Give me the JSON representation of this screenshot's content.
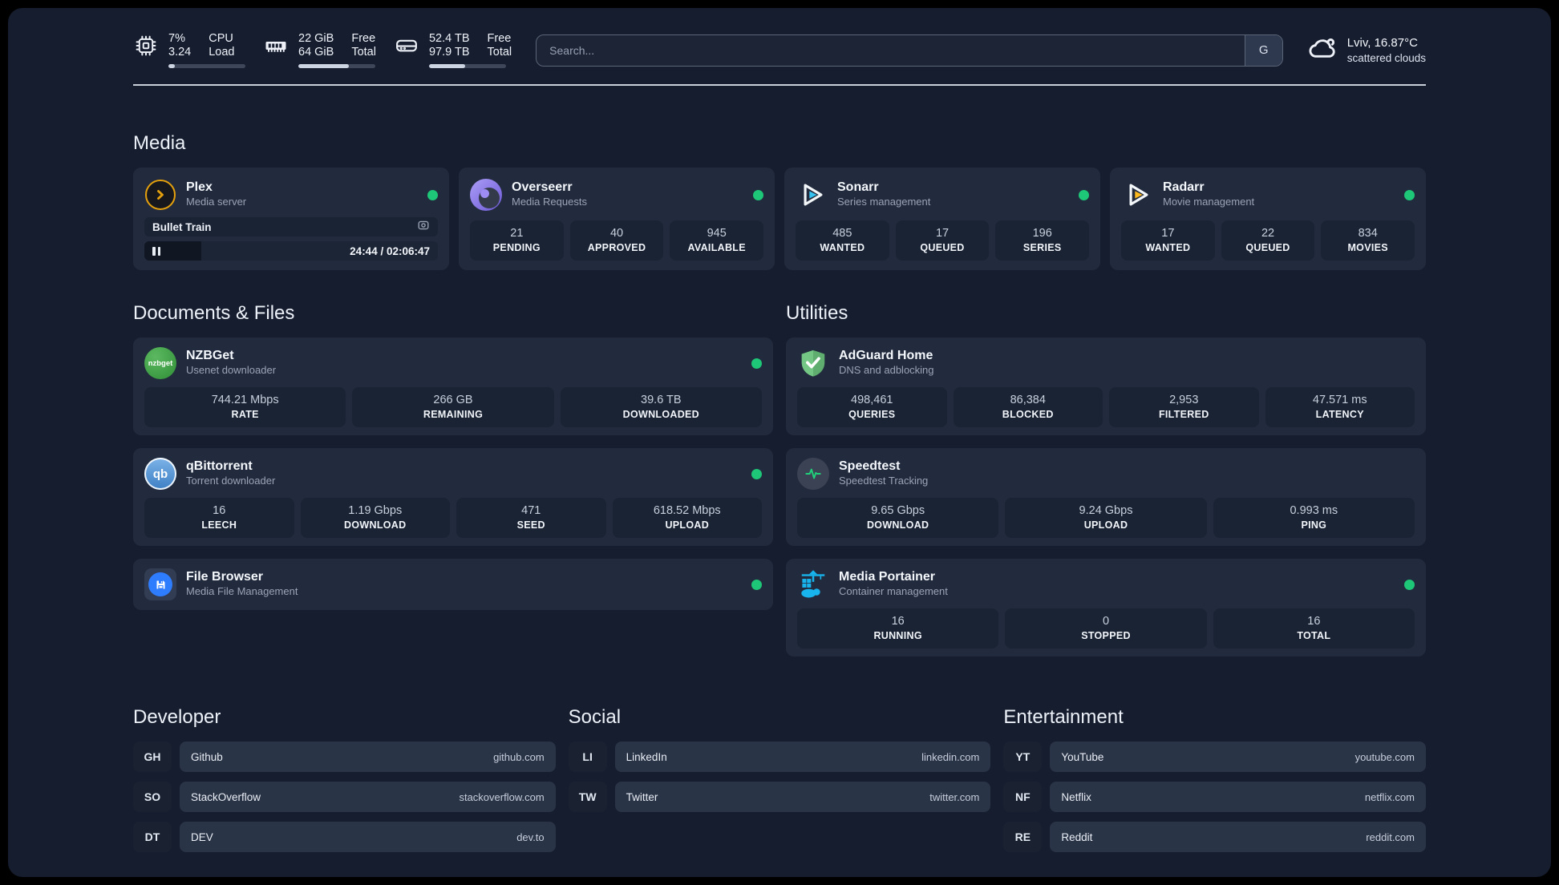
{
  "header": {
    "system_stats": [
      {
        "icon": "cpu-icon",
        "values": [
          "7%",
          "3.24"
        ],
        "labels": [
          "CPU",
          "Load"
        ],
        "progress_percent": 8
      },
      {
        "icon": "ram-icon",
        "values": [
          "22 GiB",
          "64 GiB"
        ],
        "labels": [
          "Free",
          "Total"
        ],
        "progress_percent": 66
      },
      {
        "icon": "disk-icon",
        "values": [
          "52.4 TB",
          "97.9 TB"
        ],
        "labels": [
          "Free",
          "Total"
        ],
        "progress_percent": 47
      }
    ],
    "search": {
      "placeholder": "Search...",
      "button_label": "G"
    },
    "weather": {
      "icon": "cloud-icon",
      "title": "Lviv, 16.87°C",
      "subtitle": "scattered clouds"
    }
  },
  "sections": {
    "media": {
      "title": "Media",
      "cards": [
        {
          "icon": "plex-icon",
          "name": "Plex",
          "subtitle": "Media server",
          "status_online": true,
          "now_playing": {
            "title": "Bullet Train",
            "icon": "camera-icon"
          },
          "player": {
            "state": "paused",
            "icon": "pause-icon",
            "time": "24:44 / 02:06:47",
            "progress_percent": 19.5
          }
        },
        {
          "icon": "overseerr-icon",
          "name": "Overseerr",
          "subtitle": "Media Requests",
          "status_online": true,
          "stats": [
            {
              "value": "21",
              "label": "PENDING"
            },
            {
              "value": "40",
              "label": "APPROVED"
            },
            {
              "value": "945",
              "label": "AVAILABLE"
            }
          ]
        },
        {
          "icon": "sonarr-icon",
          "name": "Sonarr",
          "subtitle": "Series management",
          "status_online": true,
          "stats": [
            {
              "value": "485",
              "label": "WANTED"
            },
            {
              "value": "17",
              "label": "QUEUED"
            },
            {
              "value": "196",
              "label": "SERIES"
            }
          ]
        },
        {
          "icon": "radarr-icon",
          "name": "Radarr",
          "subtitle": "Movie management",
          "status_online": true,
          "stats": [
            {
              "value": "17",
              "label": "WANTED"
            },
            {
              "value": "22",
              "label": "QUEUED"
            },
            {
              "value": "834",
              "label": "MOVIES"
            }
          ]
        }
      ]
    },
    "documents": {
      "title": "Documents & Files",
      "cards": [
        {
          "icon": "nzbget-icon",
          "icon_text": "nzbget",
          "name": "NZBGet",
          "subtitle": "Usenet downloader",
          "status_online": true,
          "stats": [
            {
              "value": "744.21 Mbps",
              "label": "RATE"
            },
            {
              "value": "266 GB",
              "label": "REMAINING"
            },
            {
              "value": "39.6 TB",
              "label": "DOWNLOADED"
            }
          ]
        },
        {
          "icon": "qbittorrent-icon",
          "icon_text": "qb",
          "name": "qBittorrent",
          "subtitle": "Torrent downloader",
          "status_online": true,
          "stats": [
            {
              "value": "16",
              "label": "LEECH"
            },
            {
              "value": "1.19 Gbps",
              "label": "DOWNLOAD"
            },
            {
              "value": "471",
              "label": "SEED"
            },
            {
              "value": "618.52 Mbps",
              "label": "UPLOAD"
            }
          ]
        },
        {
          "icon": "filebrowser-icon",
          "name": "File Browser",
          "subtitle": "Media File Management",
          "status_online": true
        }
      ]
    },
    "utilities": {
      "title": "Utilities",
      "cards": [
        {
          "icon": "adguard-icon",
          "name": "AdGuard Home",
          "subtitle": "DNS and adblocking",
          "status_online": false,
          "stats": [
            {
              "value": "498,461",
              "label": "QUERIES"
            },
            {
              "value": "86,384",
              "label": "BLOCKED"
            },
            {
              "value": "2,953",
              "label": "FILTERED"
            },
            {
              "value": "47.571 ms",
              "label": "LATENCY"
            }
          ]
        },
        {
          "icon": "speedtest-icon",
          "name": "Speedtest",
          "subtitle": "Speedtest Tracking",
          "status_online": false,
          "stats": [
            {
              "value": "9.65 Gbps",
              "label": "DOWNLOAD"
            },
            {
              "value": "9.24 Gbps",
              "label": "UPLOAD"
            },
            {
              "value": "0.993 ms",
              "label": "PING"
            }
          ]
        },
        {
          "icon": "portainer-icon",
          "name": "Media Portainer",
          "subtitle": "Container management",
          "status_online": true,
          "stats": [
            {
              "value": "16",
              "label": "RUNNING"
            },
            {
              "value": "0",
              "label": "STOPPED"
            },
            {
              "value": "16",
              "label": "TOTAL"
            }
          ]
        }
      ]
    },
    "links": [
      {
        "title": "Developer",
        "items": [
          {
            "abbr": "GH",
            "name": "Github",
            "domain": "github.com"
          },
          {
            "abbr": "SO",
            "name": "StackOverflow",
            "domain": "stackoverflow.com"
          },
          {
            "abbr": "DT",
            "name": "DEV",
            "domain": "dev.to"
          }
        ]
      },
      {
        "title": "Social",
        "items": [
          {
            "abbr": "LI",
            "name": "LinkedIn",
            "domain": "linkedin.com"
          },
          {
            "abbr": "TW",
            "name": "Twitter",
            "domain": "twitter.com"
          }
        ]
      },
      {
        "title": "Entertainment",
        "items": [
          {
            "abbr": "YT",
            "name": "YouTube",
            "domain": "youtube.com"
          },
          {
            "abbr": "NF",
            "name": "Netflix",
            "domain": "netflix.com"
          },
          {
            "abbr": "RE",
            "name": "Reddit",
            "domain": "reddit.com"
          }
        ]
      }
    ]
  },
  "colors": {
    "status_online": "#1ec677",
    "plex_accent": "#e5a00d",
    "sonarr_accent": "#36c3f2",
    "radarr_accent": "#fdb81e",
    "nzbget_accent": "#3f9e3f",
    "qbittorrent_accent": "#4a90d9",
    "adguard_accent": "#68b878",
    "overseerr_accent": "#7c6bdd",
    "portainer_accent": "#18b4ee",
    "speedtest_accent": "#21d07a",
    "filebrowser_accent": "#2f7dff"
  }
}
